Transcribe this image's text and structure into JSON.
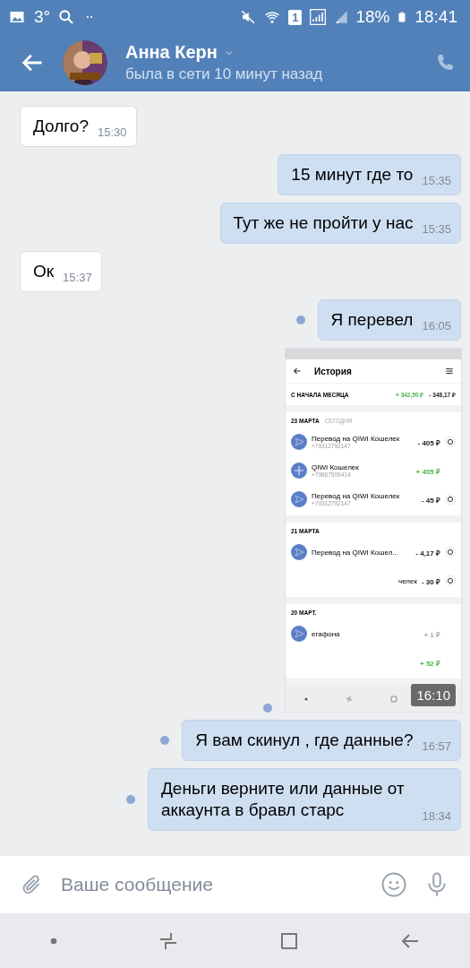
{
  "status_bar": {
    "temperature": "3°",
    "sim_label": "1",
    "battery": "18%",
    "time": "18:41"
  },
  "header": {
    "name": "Анна Керн",
    "status": "была в сети 10 минут назад"
  },
  "messages": [
    {
      "kind": "incoming_text",
      "text": "Долго?",
      "time": "15:30"
    },
    {
      "kind": "outgoing_text",
      "text": "15 минут где то",
      "time": "15:35",
      "unread": false
    },
    {
      "kind": "outgoing_text",
      "text": "Тут же не пройти у нас",
      "time": "15:35",
      "unread": false
    },
    {
      "kind": "incoming_text",
      "text": "Ок",
      "time": "15:37"
    },
    {
      "kind": "outgoing_text",
      "text": "Я перевел",
      "time": "16:05",
      "unread": true
    },
    {
      "kind": "outgoing_image",
      "time": "16:10",
      "unread": true,
      "screenshot": {
        "title": "История",
        "summary": {
          "label": "С НАЧАЛА МЕСЯЦА",
          "income": "+ 342,50 ₽",
          "expense": "- 348,17 ₽"
        },
        "groups": [
          {
            "date": "23 МАРТА",
            "note": "СЕГОДНЯ",
            "rows": [
              {
                "kind": "transfer",
                "name": "Перевод на QIWI Кошелек",
                "phone": "+79312792147",
                "amount": "- 405 ₽",
                "color": "#222222",
                "repeat": true
              },
              {
                "kind": "top_up",
                "name": "QIWI Кошелек",
                "phone": "+79867509414",
                "amount": "+ 405 ₽",
                "color": "#4bb34b",
                "repeat": false
              },
              {
                "kind": "transfer",
                "name": "Перевод на QIWI Кошелек",
                "phone": "+79312792147",
                "amount": "- 45 ₽",
                "color": "#222222",
                "repeat": true
              }
            ]
          },
          {
            "date": "21 МАРТА",
            "rows": [
              {
                "kind": "transfer",
                "name": "Перевод на QIWI Кошел...",
                "amount": "- 4,17 ₽",
                "color": "#222222",
                "repeat": true
              },
              {
                "kind": "hidden",
                "name": "челек",
                "amount": "- 30 ₽",
                "color": "#222222",
                "repeat": true
              }
            ]
          },
          {
            "date": "20 МАРТ.",
            "rows": [
              {
                "kind": "transfer",
                "name": "егафона",
                "amount": "+ 1 ₽",
                "color": "#aaaaaa",
                "repeat": false
              },
              {
                "kind": "hidden",
                "amount": "+ 52 ₽",
                "color": "#4bb34b",
                "repeat": false
              }
            ]
          }
        ]
      }
    },
    {
      "kind": "outgoing_text",
      "text": "Я вам скинул , где данные?",
      "time": "16:57",
      "unread": true
    },
    {
      "kind": "outgoing_text",
      "text": "Деньги верните или данные от аккаунта в бравл старс",
      "time": "18:34",
      "unread": true
    }
  ],
  "composer": {
    "placeholder": "Ваше сообщение"
  }
}
